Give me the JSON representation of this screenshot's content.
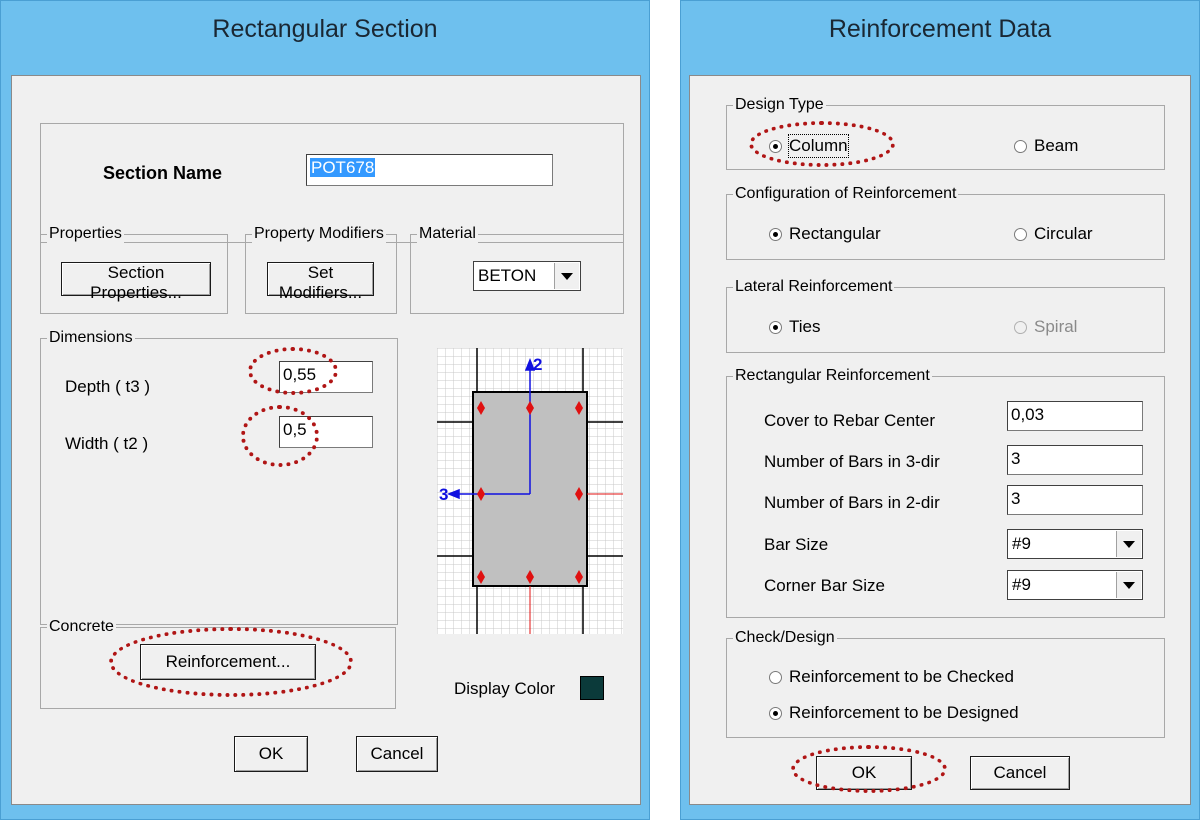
{
  "left_dialog": {
    "title": "Rectangular Section",
    "section_name_label": "Section Name",
    "section_name_value": "POT678",
    "properties_group": "Properties",
    "section_properties_button": "Section Properties...",
    "property_modifiers_group": "Property Modifiers",
    "set_modifiers_button": "Set Modifiers...",
    "material_group": "Material",
    "material_value": "BETON",
    "dimensions_group": "Dimensions",
    "depth_label": "Depth ( t3 )",
    "depth_value": "0,55",
    "width_label": "Width ( t2 )",
    "width_value": "0,5",
    "concrete_group": "Concrete",
    "reinforcement_button": "Reinforcement...",
    "display_color_label": "Display Color",
    "display_color": "#0b3a3a",
    "ok_button": "OK",
    "cancel_button": "Cancel",
    "preview": {
      "axis2_label": "2",
      "axis3_label": "3"
    }
  },
  "right_dialog": {
    "title": "Reinforcement Data",
    "design_type_group": "Design Type",
    "column_option": "Column",
    "beam_option": "Beam",
    "configuration_group": "Configuration of Reinforcement",
    "rectangular_option": "Rectangular",
    "circular_option": "Circular",
    "lateral_group": "Lateral Reinforcement",
    "ties_option": "Ties",
    "spiral_option": "Spiral",
    "rect_reinf_group": "Rectangular Reinforcement",
    "cover_label": "Cover to Rebar Center",
    "cover_value": "0,03",
    "bars3_label": "Number of Bars in 3-dir",
    "bars3_value": "3",
    "bars2_label": "Number of Bars in 2-dir",
    "bars2_value": "3",
    "bar_size_label": "Bar Size",
    "bar_size_value": "#9",
    "corner_bar_label": "Corner Bar Size",
    "corner_bar_value": "#9",
    "check_design_group": "Check/Design",
    "checked_option": "Reinforcement to be Checked",
    "designed_option": "Reinforcement to be Designed",
    "ok_button": "OK",
    "cancel_button": "Cancel"
  },
  "colors": {
    "titlebar": "#6ec0ee",
    "highlight": "#b01515",
    "rebar": "#e01010",
    "axis": "#1010e0"
  }
}
